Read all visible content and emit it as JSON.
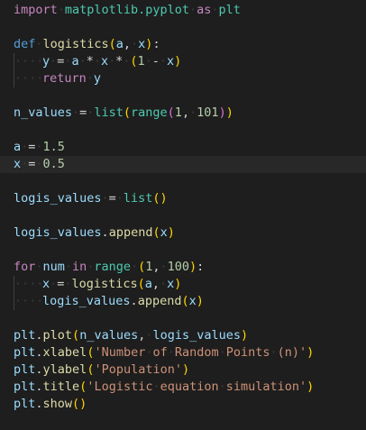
{
  "theme": {
    "background": "#1e1e1e",
    "keyword_control": "#c586c0",
    "keyword_def": "#569cd6",
    "function": "#dcdcaa",
    "variable": "#9cdcfe",
    "module": "#4ec9b0",
    "number": "#b5cea8",
    "string": "#ce9178",
    "bracket1": "#ffd700",
    "bracket2": "#da70d6",
    "operator": "#d4d4d4",
    "plain": "#d4d4d4"
  },
  "lines": [
    {
      "indent": 0,
      "tokens": [
        [
          "import",
          "keyword_control"
        ],
        [
          " ",
          "sp"
        ],
        [
          "matplotlib.pyplot",
          "module"
        ],
        [
          " ",
          "sp"
        ],
        [
          "as",
          "keyword_control"
        ],
        [
          " ",
          "sp"
        ],
        [
          "plt",
          "module"
        ]
      ]
    },
    {
      "indent": 0,
      "tokens": []
    },
    {
      "indent": 0,
      "tokens": [
        [
          "def",
          "keyword_def"
        ],
        [
          " ",
          "sp"
        ],
        [
          "logistics",
          "function"
        ],
        [
          "(",
          "bracket1"
        ],
        [
          "a",
          "variable"
        ],
        [
          ",",
          "plain"
        ],
        [
          " ",
          "sp"
        ],
        [
          "x",
          "variable"
        ],
        [
          ")",
          "bracket1"
        ],
        [
          ":",
          "plain"
        ]
      ]
    },
    {
      "indent": 1,
      "tokens": [
        [
          "y",
          "variable"
        ],
        [
          " ",
          "sp"
        ],
        [
          "=",
          "operator"
        ],
        [
          " ",
          "sp"
        ],
        [
          "a",
          "variable"
        ],
        [
          " ",
          "sp"
        ],
        [
          "*",
          "operator"
        ],
        [
          " ",
          "sp"
        ],
        [
          "x",
          "variable"
        ],
        [
          " ",
          "sp"
        ],
        [
          "*",
          "operator"
        ],
        [
          " ",
          "sp"
        ],
        [
          "(",
          "bracket1"
        ],
        [
          "1",
          "number"
        ],
        [
          " ",
          "sp"
        ],
        [
          "-",
          "operator"
        ],
        [
          " ",
          "sp"
        ],
        [
          "x",
          "variable"
        ],
        [
          ")",
          "bracket1"
        ]
      ]
    },
    {
      "indent": 1,
      "tokens": [
        [
          "return",
          "keyword_control"
        ],
        [
          " ",
          "sp"
        ],
        [
          "y",
          "variable"
        ]
      ]
    },
    {
      "indent": 0,
      "tokens": []
    },
    {
      "indent": 0,
      "tokens": [
        [
          "n_values",
          "variable"
        ],
        [
          " ",
          "sp"
        ],
        [
          "=",
          "operator"
        ],
        [
          " ",
          "sp"
        ],
        [
          "list",
          "module"
        ],
        [
          "(",
          "bracket1"
        ],
        [
          "range",
          "module"
        ],
        [
          "(",
          "bracket2"
        ],
        [
          "1",
          "number"
        ],
        [
          ",",
          "plain"
        ],
        [
          " ",
          "sp"
        ],
        [
          "101",
          "number"
        ],
        [
          ")",
          "bracket2"
        ],
        [
          ")",
          "bracket1"
        ]
      ]
    },
    {
      "indent": 0,
      "tokens": []
    },
    {
      "indent": 0,
      "tokens": [
        [
          "a",
          "variable"
        ],
        [
          " ",
          "sp"
        ],
        [
          "=",
          "operator"
        ],
        [
          " ",
          "sp"
        ],
        [
          "1.5",
          "number"
        ]
      ]
    },
    {
      "indent": 0,
      "current": true,
      "tokens": [
        [
          "x",
          "variable"
        ],
        [
          " ",
          "sp"
        ],
        [
          "=",
          "operator"
        ],
        [
          " ",
          "sp"
        ],
        [
          "0.5",
          "number"
        ]
      ]
    },
    {
      "indent": 0,
      "tokens": []
    },
    {
      "indent": 0,
      "tokens": [
        [
          "logis_values",
          "variable"
        ],
        [
          " ",
          "sp"
        ],
        [
          "=",
          "operator"
        ],
        [
          " ",
          "sp"
        ],
        [
          "list",
          "module"
        ],
        [
          "()",
          "bracket1"
        ]
      ]
    },
    {
      "indent": 0,
      "tokens": []
    },
    {
      "indent": 0,
      "tokens": [
        [
          "logis_values",
          "variable"
        ],
        [
          ".",
          "plain"
        ],
        [
          "append",
          "function"
        ],
        [
          "(",
          "bracket1"
        ],
        [
          "x",
          "variable"
        ],
        [
          ")",
          "bracket1"
        ]
      ]
    },
    {
      "indent": 0,
      "tokens": []
    },
    {
      "indent": 0,
      "tokens": [
        [
          "for",
          "keyword_control"
        ],
        [
          " ",
          "sp"
        ],
        [
          "num",
          "variable"
        ],
        [
          " ",
          "sp"
        ],
        [
          "in",
          "keyword_control"
        ],
        [
          " ",
          "sp"
        ],
        [
          "range",
          "module"
        ],
        [
          " ",
          "sp"
        ],
        [
          "(",
          "bracket1"
        ],
        [
          "1",
          "number"
        ],
        [
          ",",
          "plain"
        ],
        [
          " ",
          "sp"
        ],
        [
          "100",
          "number"
        ],
        [
          ")",
          "bracket1"
        ],
        [
          ":",
          "plain"
        ]
      ]
    },
    {
      "indent": 1,
      "tokens": [
        [
          "x",
          "variable"
        ],
        [
          " ",
          "sp"
        ],
        [
          "=",
          "operator"
        ],
        [
          " ",
          "sp"
        ],
        [
          "logistics",
          "function"
        ],
        [
          "(",
          "bracket1"
        ],
        [
          "a",
          "variable"
        ],
        [
          ",",
          "plain"
        ],
        [
          " ",
          "sp"
        ],
        [
          "x",
          "variable"
        ],
        [
          ")",
          "bracket1"
        ]
      ]
    },
    {
      "indent": 1,
      "tokens": [
        [
          "logis_values",
          "variable"
        ],
        [
          ".",
          "plain"
        ],
        [
          "append",
          "function"
        ],
        [
          "(",
          "bracket1"
        ],
        [
          "x",
          "variable"
        ],
        [
          ")",
          "bracket1"
        ]
      ]
    },
    {
      "indent": 0,
      "tokens": []
    },
    {
      "indent": 0,
      "tokens": [
        [
          "plt",
          "variable"
        ],
        [
          ".",
          "plain"
        ],
        [
          "plot",
          "function"
        ],
        [
          "(",
          "bracket1"
        ],
        [
          "n_values",
          "variable"
        ],
        [
          ",",
          "plain"
        ],
        [
          " ",
          "sp"
        ],
        [
          "logis_values",
          "variable"
        ],
        [
          ")",
          "bracket1"
        ]
      ]
    },
    {
      "indent": 0,
      "tokens": [
        [
          "plt",
          "variable"
        ],
        [
          ".",
          "plain"
        ],
        [
          "xlabel",
          "function"
        ],
        [
          "(",
          "bracket1"
        ],
        [
          "'Number",
          "string"
        ],
        [
          " ",
          "sp"
        ],
        [
          "of",
          "string"
        ],
        [
          " ",
          "sp"
        ],
        [
          "Random",
          "string"
        ],
        [
          " ",
          "sp"
        ],
        [
          "Points",
          "string"
        ],
        [
          " ",
          "sp"
        ],
        [
          "(n)'",
          "string"
        ],
        [
          ")",
          "bracket1"
        ]
      ]
    },
    {
      "indent": 0,
      "tokens": [
        [
          "plt",
          "variable"
        ],
        [
          ".",
          "plain"
        ],
        [
          "ylabel",
          "function"
        ],
        [
          "(",
          "bracket1"
        ],
        [
          "'Population'",
          "string"
        ],
        [
          ")",
          "bracket1"
        ]
      ]
    },
    {
      "indent": 0,
      "tokens": [
        [
          "plt",
          "variable"
        ],
        [
          ".",
          "plain"
        ],
        [
          "title",
          "function"
        ],
        [
          "(",
          "bracket1"
        ],
        [
          "'Logistic",
          "string"
        ],
        [
          " ",
          "sp"
        ],
        [
          "equation",
          "string"
        ],
        [
          " ",
          "sp"
        ],
        [
          "simulation'",
          "string"
        ],
        [
          ")",
          "bracket1"
        ]
      ]
    },
    {
      "indent": 0,
      "tokens": [
        [
          "plt",
          "variable"
        ],
        [
          ".",
          "plain"
        ],
        [
          "show",
          "function"
        ],
        [
          "()",
          "bracket1"
        ]
      ]
    }
  ]
}
